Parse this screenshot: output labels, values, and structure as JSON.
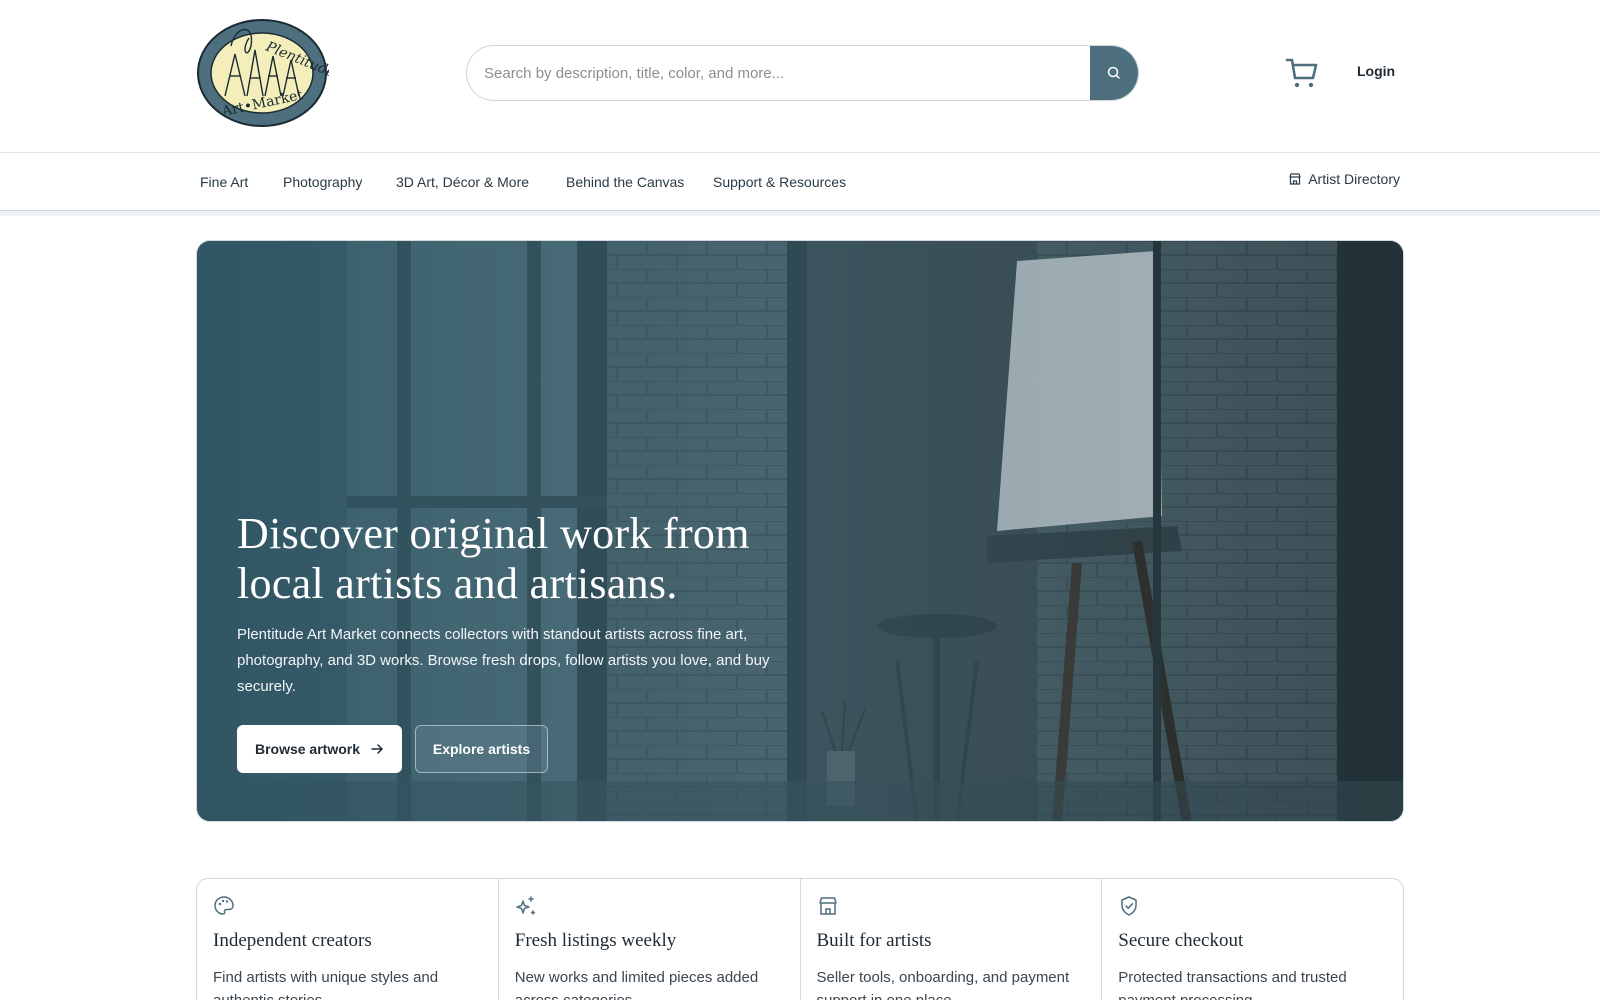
{
  "brand": {
    "logo_top_text": "Plentitude",
    "logo_bottom_text": "Art•Market"
  },
  "search": {
    "placeholder": "Search by description, title, color, and more..."
  },
  "header": {
    "login_label": "Login"
  },
  "nav": {
    "items": [
      {
        "label": "Fine Art"
      },
      {
        "label": "Photography"
      },
      {
        "label": "3D Art, Décor & More"
      },
      {
        "label": "Behind the Canvas"
      },
      {
        "label": "Support & Resources"
      }
    ],
    "artist_directory_label": "Artist Directory"
  },
  "hero": {
    "title": "Discover original work from local artists and artisans.",
    "subtitle": "Plentitude Art Market connects collectors with standout artists across fine art, photography, and 3D works. Browse fresh drops, follow artists you love, and buy securely.",
    "primary_button": "Browse artwork",
    "secondary_button": "Explore artists"
  },
  "features": [
    {
      "icon": "palette-icon",
      "title": "Independent creators",
      "text": "Find artists with unique styles and authentic stories."
    },
    {
      "icon": "sparkles-icon",
      "title": "Fresh listings weekly",
      "text": "New works and limited pieces added across categories."
    },
    {
      "icon": "store-icon",
      "title": "Built for artists",
      "text": "Seller tools, onboarding, and payment support in one place."
    },
    {
      "icon": "shield-check-icon",
      "title": "Secure checkout",
      "text": "Protected transactions and trusted payment processing."
    }
  ],
  "colors": {
    "accent": "#4e6f7e",
    "hero_overlay": "#3e6472",
    "logo_fill": "#f4eebb"
  }
}
